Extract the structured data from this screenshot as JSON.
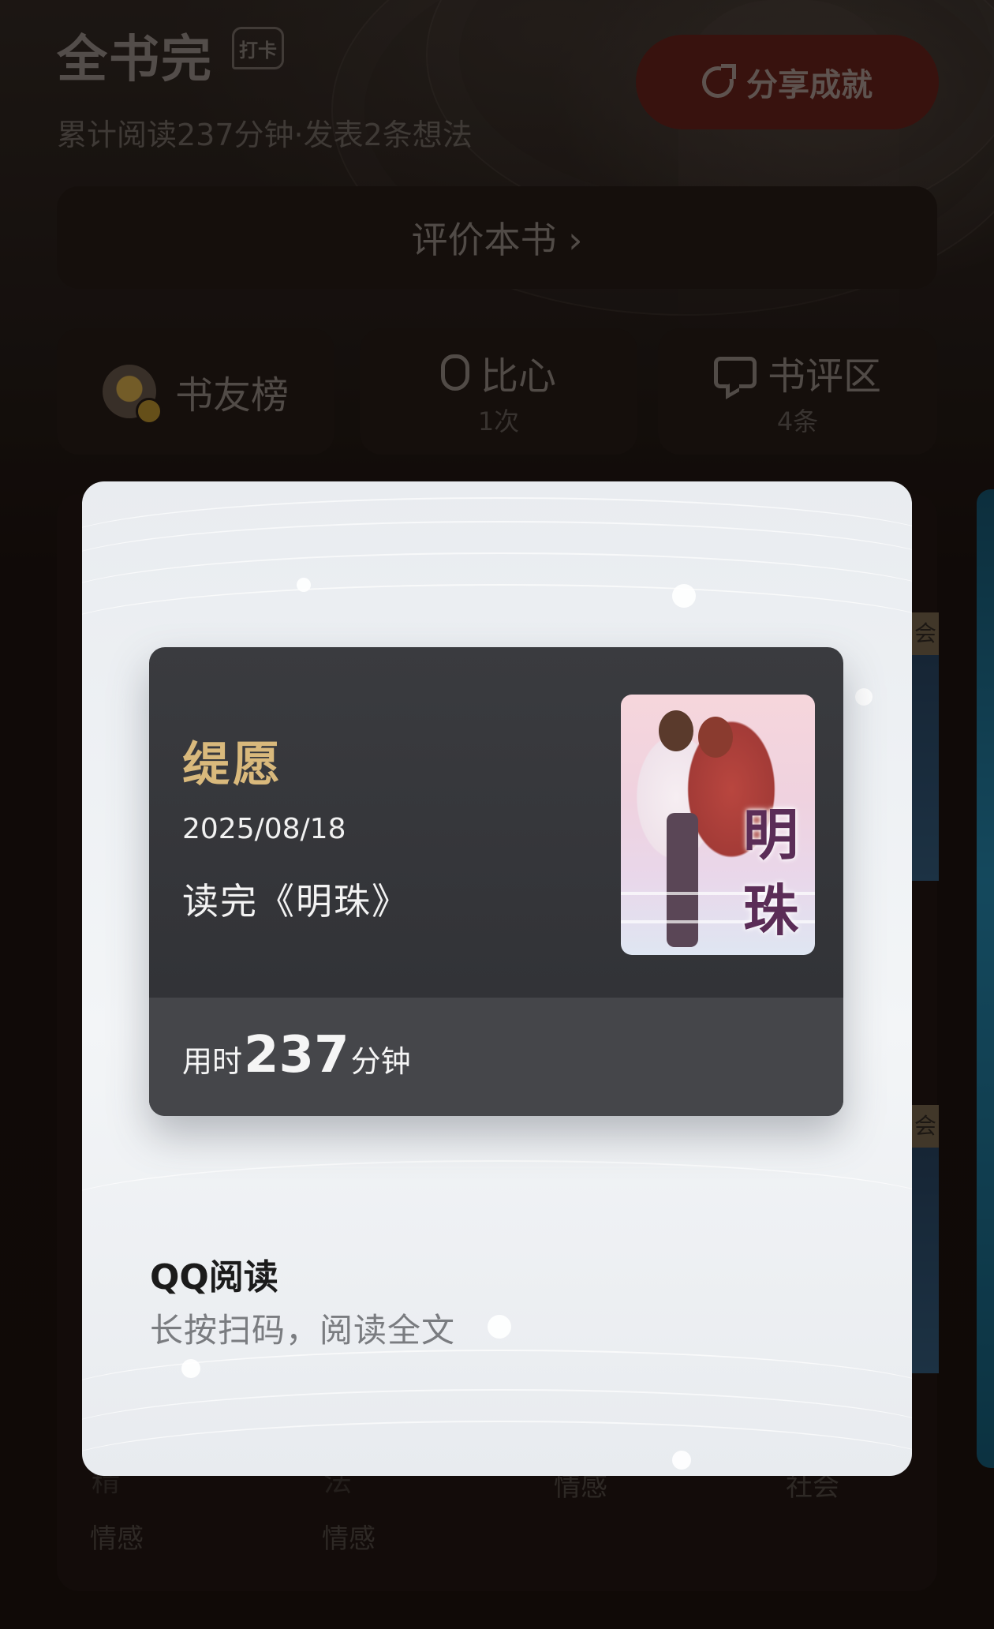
{
  "header": {
    "title": "全书完",
    "checkin_badge": "打卡",
    "subtitle": "累计阅读237分钟·发表2条想法",
    "share_button": "分享成就"
  },
  "rate_bar": {
    "label": "评价本书 ›"
  },
  "stats": [
    {
      "label": "书友榜",
      "sub": ""
    },
    {
      "label": "比心",
      "sub": "1次"
    },
    {
      "label": "书评区",
      "sub": "4条"
    }
  ],
  "background_tags": {
    "row1": [
      "情感",
      "情感"
    ],
    "row2": [
      "情感",
      "社会"
    ],
    "hidden_chars": [
      "精",
      "法"
    ],
    "side_badge": "会"
  },
  "poster": {
    "user_name": "缇愿",
    "date": "2025/08/18",
    "finished_text": "读完《明珠》",
    "time_prefix": "用时",
    "time_value": "237",
    "time_unit": "分钟",
    "cover_title": "明珠",
    "app_name": "QQ阅读",
    "hint": "长按扫码，阅读全文"
  },
  "colors": {
    "page_bg": "#170f0c",
    "share_button_bg": "#5e1d17",
    "user_name": "#d9b97c",
    "ticket_bg": "#3a3b3f",
    "poster_bg": "#eef1f4"
  },
  "icons": {
    "share": "share-refresh-icon",
    "heart_hand": "finger-heart-icon",
    "comment": "comment-bubble-icon",
    "avatar": "sunflower-avatar"
  }
}
